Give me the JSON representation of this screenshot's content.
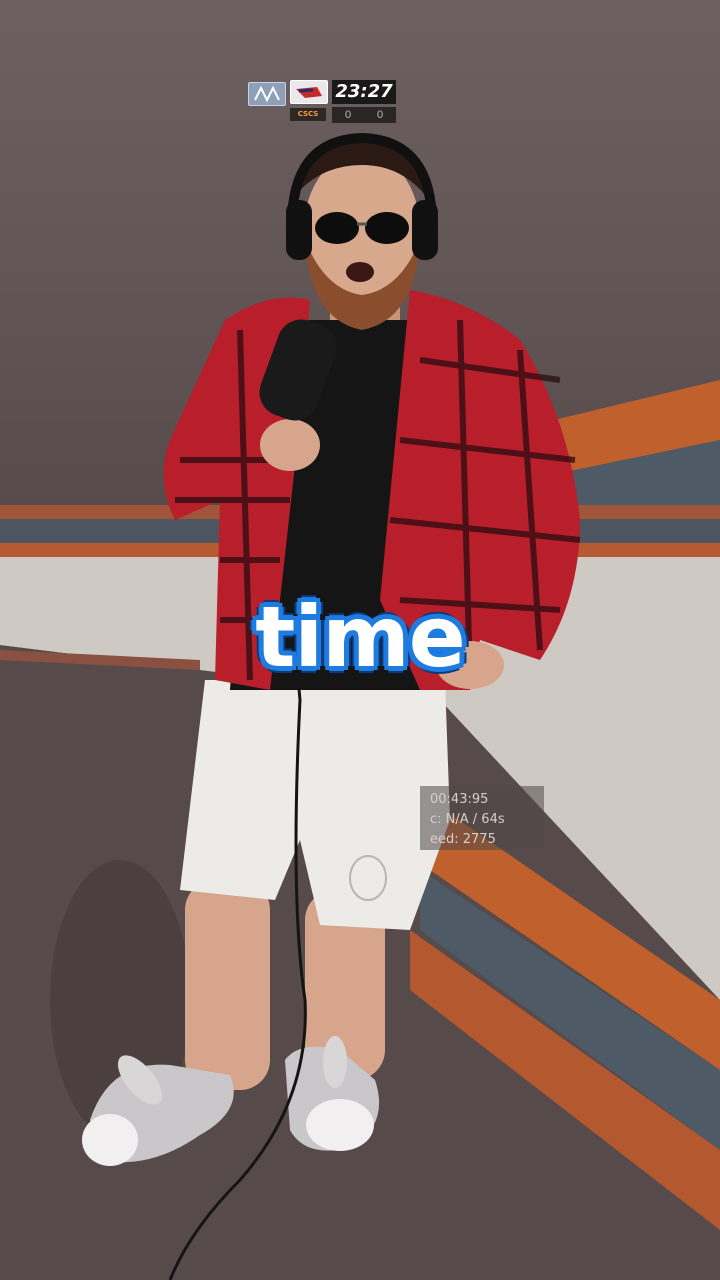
{
  "hud": {
    "timer": "23:27",
    "team_left_score": "0",
    "team_right_score": "0",
    "team_right_tag": "CSCS",
    "team_left_icon": "team-logo-icon",
    "team_right_icon": "team-logo-icon"
  },
  "stats": {
    "line1": "00:43:95",
    "line2": "c: N/A / 64s",
    "line3": "eed: 2775"
  },
  "caption": {
    "word": "time"
  },
  "colors": {
    "caption_outline": "#1e7be0",
    "wall_orange": "#c0602c",
    "wall_slate": "#4e5a66"
  }
}
